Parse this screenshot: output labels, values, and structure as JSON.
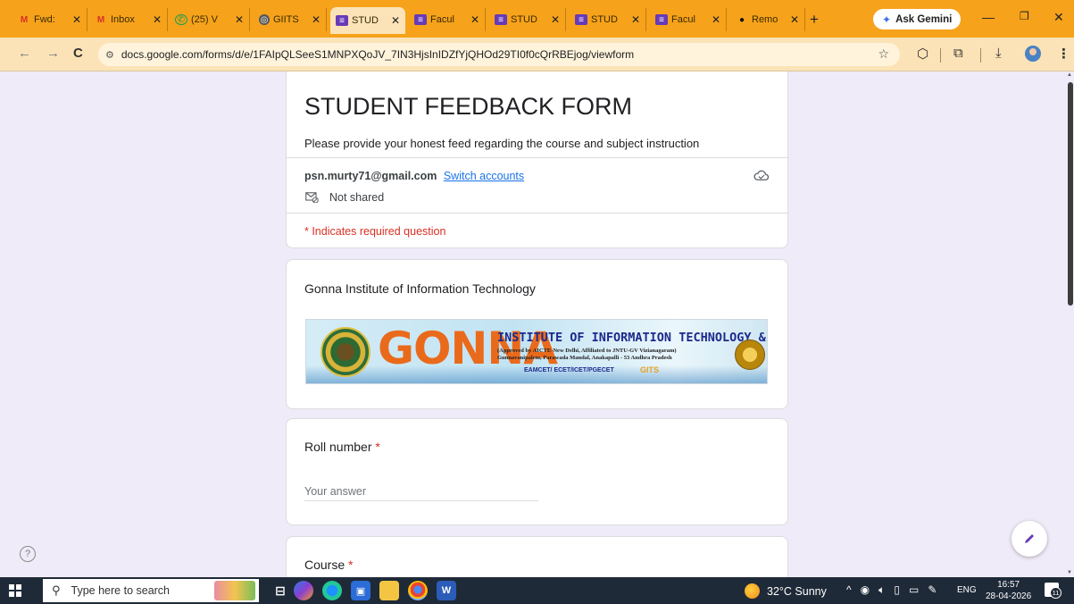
{
  "browser": {
    "tabs": [
      {
        "favicon": "gmail-icon",
        "title": "Fwd:",
        "active": false
      },
      {
        "favicon": "gmail-icon",
        "title": "Inbox",
        "active": false
      },
      {
        "favicon": "whatsapp-icon",
        "title": "(25) V",
        "active": false
      },
      {
        "favicon": "globe-icon",
        "title": "GIITS",
        "active": false
      },
      {
        "favicon": "google-forms-icon",
        "title": "STUD",
        "active": true
      },
      {
        "favicon": "google-forms-icon",
        "title": "Facul",
        "active": false
      },
      {
        "favicon": "google-forms-icon",
        "title": "STUD",
        "active": false
      },
      {
        "favicon": "google-forms-icon",
        "title": "STUD",
        "active": false
      },
      {
        "favicon": "google-forms-icon",
        "title": "Facul",
        "active": false
      },
      {
        "favicon": "remote-icon",
        "title": "Remo",
        "active": false
      }
    ],
    "new_tab": "+",
    "gemini_label": "Ask Gemini",
    "url": "docs.google.com/forms/d/e/1FAIpQLSeeS1MNPXQoJV_7IN3HjsInIDZfYjQHOd29TI0f0cQrRBEjog/viewform",
    "accent_color": "#f6a21b"
  },
  "form": {
    "title": "STUDENT FEEDBACK FORM",
    "description": "Please provide your honest feed regarding the course and subject instruction",
    "account_email": "psn.murty71@gmail.com",
    "switch_accounts": "Switch accounts",
    "not_shared": "Not shared",
    "required_note": "* Indicates required question",
    "theme_color": "#673ab7",
    "required_color": "#d93025"
  },
  "institute": {
    "label": "Gonna Institute of Information Technology",
    "banner": {
      "big_word": "GONNA",
      "full_name": "INSTITUTE OF INFORMATION TECHNOLOGY & SCIENCES",
      "approval_line": "(Approved by AICTE-New Delhi, Affiliated to JNTU-GV Vizianagaram)",
      "address_line": "Gunnavanipalem, Parawada Mandal, Anakapalli - 53 Andhra Pradesh",
      "exams": "EAMCET/ ECET/ICET/PGECET",
      "code": "GITS"
    }
  },
  "questions": [
    {
      "label": "Roll number",
      "required_mark": "*",
      "placeholder": "Your answer"
    },
    {
      "label": "Course",
      "required_mark": "*"
    }
  ],
  "taskbar": {
    "search_placeholder": "Type here to search",
    "weather": "32°C  Sunny",
    "language": "ENG",
    "time": "16:57",
    "date": "28-04-2026",
    "notification_count": "11"
  }
}
